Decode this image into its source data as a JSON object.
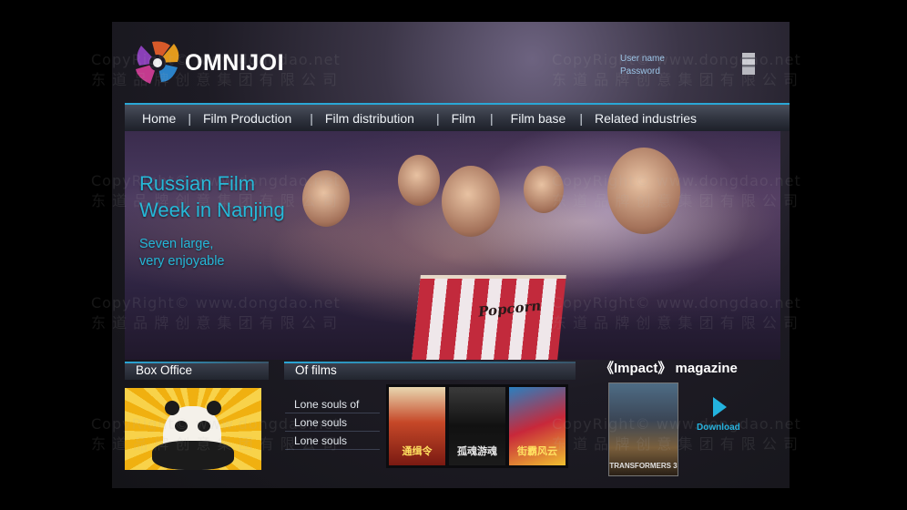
{
  "brand": {
    "name": "OMNIJOI"
  },
  "login": {
    "username_label": "User name",
    "password_label": "Password"
  },
  "nav": {
    "items": [
      "Home",
      "Film Production",
      "Film distribution",
      "Film",
      "Film base",
      "Related industries"
    ],
    "separator": "|"
  },
  "hero": {
    "title_line1": "Russian Film",
    "title_line2": "Week in Nanjing",
    "subtitle_line1": "Seven large,",
    "subtitle_line2": "very enjoyable",
    "popcorn_text": "Popcorn"
  },
  "box_office": {
    "heading": "Box Office"
  },
  "of_films": {
    "heading": "Of films",
    "items": [
      "Lone souls of",
      "Lone souls",
      "Lone souls"
    ],
    "posters": [
      {
        "title": "通缉令"
      },
      {
        "title": "孤魂游魂"
      },
      {
        "title": "街霸风云"
      }
    ]
  },
  "magazine": {
    "title": "《Impact》 magazine",
    "cover_text": "TRANSFORMERS 3",
    "download_label": "Download"
  },
  "watermark": {
    "line1": "CopyRight© www.dongdao.net",
    "line2": "东 道 品 牌 创 意 集 团 有 限 公 司"
  },
  "colors": {
    "accent": "#25b8d8",
    "nav_top": "#2aa7d6",
    "background": "#000000"
  }
}
